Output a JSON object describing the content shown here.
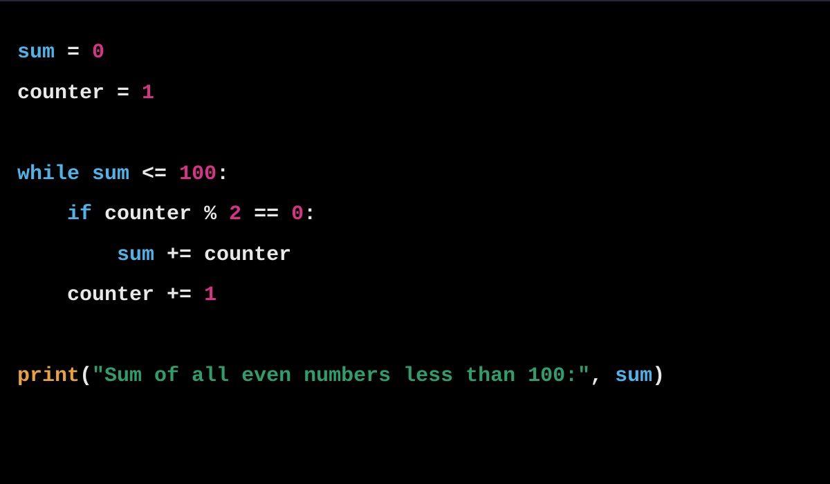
{
  "code": {
    "line1": {
      "token1": "sum",
      "token2": " = ",
      "token3": "0"
    },
    "line2": {
      "token1": "counter ",
      "token2": "= ",
      "token3": "1"
    },
    "line3": {
      "token1": "while",
      "token2": " ",
      "token3": "sum",
      "token4": " <= ",
      "token5": "100",
      "token6": ":"
    },
    "line4": {
      "indent": "    ",
      "token1": "if",
      "token2": " counter ",
      "token3": "%",
      "token4": " ",
      "token5": "2",
      "token6": " == ",
      "token7": "0",
      "token8": ":"
    },
    "line5": {
      "indent": "        ",
      "token1": "sum",
      "token2": " += counter"
    },
    "line6": {
      "indent": "    ",
      "token1": "counter += ",
      "token2": "1"
    },
    "line7": {
      "token1": "print",
      "token2": "(",
      "token3": "\"Sum of all even numbers less than 100:\"",
      "token4": ", ",
      "token5": "sum",
      "token6": ")"
    }
  }
}
